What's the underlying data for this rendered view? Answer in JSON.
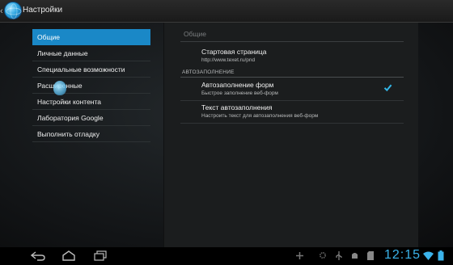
{
  "actionbar": {
    "title": "Настройки"
  },
  "leftlist": {
    "items": [
      {
        "label": "Общие"
      },
      {
        "label": "Личные данные"
      },
      {
        "label": "Специальные возможности"
      },
      {
        "label": "Расширенные"
      },
      {
        "label": "Настройки контента"
      },
      {
        "label": "Лаборатория Google"
      },
      {
        "label": "Выполнить отладку"
      }
    ],
    "selected_index": 0
  },
  "rightpane": {
    "title": "Общие",
    "homepage": {
      "title": "Стартовая страница",
      "summary": "http://www.texet.ru/pnd"
    },
    "section_header": "АВТОЗАПОЛНЕНИЕ",
    "autofill": {
      "title": "Автозаполнение форм",
      "summary": "Быстрое заполнение веб-форм",
      "checked": true
    },
    "autofill_text": {
      "title": "Текст автозаполнения",
      "summary": "Настроить текст для автозаполнения веб-форм"
    }
  },
  "statusbar": {
    "time": "12:15"
  },
  "colors": {
    "accent": "#1a88c7",
    "clock": "#3bb3ea",
    "check": "#33b5e5"
  },
  "icons": [
    "back-icon",
    "browser-logo-icon",
    "nav-back-icon",
    "nav-home-icon",
    "nav-recent-icon",
    "add-icon",
    "settings-icon",
    "usb-icon",
    "android-icon",
    "sd-card-icon",
    "wifi-icon",
    "battery-icon"
  ]
}
